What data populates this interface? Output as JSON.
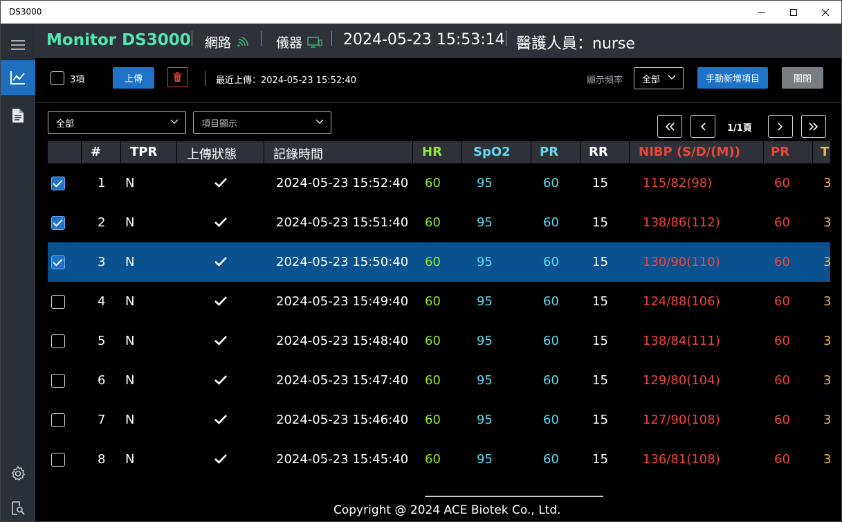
{
  "window": {
    "title": "DS3000"
  },
  "header": {
    "app_title": "Monitor DS3000",
    "network_label": "網路",
    "device_label": "儀器",
    "datetime": "2024-05-23 15:53:14",
    "staff": "醫護人員：nurse"
  },
  "toolbar": {
    "select_count": "3項",
    "upload_label": "上傳",
    "last_upload": "最近上傳：2024-05-23 15:52:40",
    "freq_label": "顯示頻率",
    "freq_value": "全部",
    "add_manual_label": "手動新增項目",
    "close_label": "關閉"
  },
  "filters": {
    "filter_value": "全部",
    "display_placeholder": "項目顯示"
  },
  "pagination": {
    "page_label": "1/1頁"
  },
  "table": {
    "columns": {
      "num": "#",
      "tpr": "TPR",
      "status": "上傳狀態",
      "time": "記錄時間",
      "hr": "HR",
      "spo2": "SpO2",
      "pr": "PR",
      "rr": "RR",
      "nibp": "NIBP (S/D/(M))",
      "pr2": "PR",
      "temp": "T"
    },
    "rows": [
      {
        "checked": true,
        "num": "1",
        "tpr": "N",
        "time": "2024-05-23 15:52:40",
        "hr": "60",
        "spo2": "95",
        "pr": "60",
        "rr": "15",
        "nibp": "115/82(98)",
        "pr2": "60",
        "temp": "3"
      },
      {
        "checked": true,
        "num": "2",
        "tpr": "N",
        "time": "2024-05-23 15:51:40",
        "hr": "60",
        "spo2": "95",
        "pr": "60",
        "rr": "15",
        "nibp": "138/86(112)",
        "pr2": "60",
        "temp": "3"
      },
      {
        "checked": true,
        "num": "3",
        "tpr": "N",
        "time": "2024-05-23 15:50:40",
        "hr": "60",
        "spo2": "95",
        "pr": "60",
        "rr": "15",
        "nibp": "130/90(110)",
        "pr2": "60",
        "temp": "3",
        "selected": true
      },
      {
        "checked": false,
        "num": "4",
        "tpr": "N",
        "time": "2024-05-23 15:49:40",
        "hr": "60",
        "spo2": "95",
        "pr": "60",
        "rr": "15",
        "nibp": "124/88(106)",
        "pr2": "60",
        "temp": "3"
      },
      {
        "checked": false,
        "num": "5",
        "tpr": "N",
        "time": "2024-05-23 15:48:40",
        "hr": "60",
        "spo2": "95",
        "pr": "60",
        "rr": "15",
        "nibp": "138/84(111)",
        "pr2": "60",
        "temp": "3"
      },
      {
        "checked": false,
        "num": "6",
        "tpr": "N",
        "time": "2024-05-23 15:47:40",
        "hr": "60",
        "spo2": "95",
        "pr": "60",
        "rr": "15",
        "nibp": "129/80(104)",
        "pr2": "60",
        "temp": "3"
      },
      {
        "checked": false,
        "num": "7",
        "tpr": "N",
        "time": "2024-05-23 15:46:40",
        "hr": "60",
        "spo2": "95",
        "pr": "60",
        "rr": "15",
        "nibp": "127/90(108)",
        "pr2": "60",
        "temp": "3"
      },
      {
        "checked": false,
        "num": "8",
        "tpr": "N",
        "time": "2024-05-23 15:45:40",
        "hr": "60",
        "spo2": "95",
        "pr": "60",
        "rr": "15",
        "nibp": "136/81(108)",
        "pr2": "60",
        "temp": "3"
      }
    ]
  },
  "footer": {
    "copyright": "Copyright @ 2024 ACE Biotek Co., Ltd."
  },
  "colors": {
    "brand": "#56e6b4",
    "hr": "#8ee832",
    "spo2": "#5fd9ee",
    "pr": "#5fd9ee",
    "nibp": "#f0443a",
    "temp": "#f2b44a",
    "primary_button": "#1e73c8",
    "selected_row": "#0a5190",
    "header_bg": "#2e3238",
    "sidebar_bg": "#2b3037"
  },
  "icons": {
    "sidebar": [
      "menu-icon",
      "chart-icon",
      "document-icon",
      "settings-icon",
      "logout-icon"
    ],
    "status": "check-icon"
  }
}
